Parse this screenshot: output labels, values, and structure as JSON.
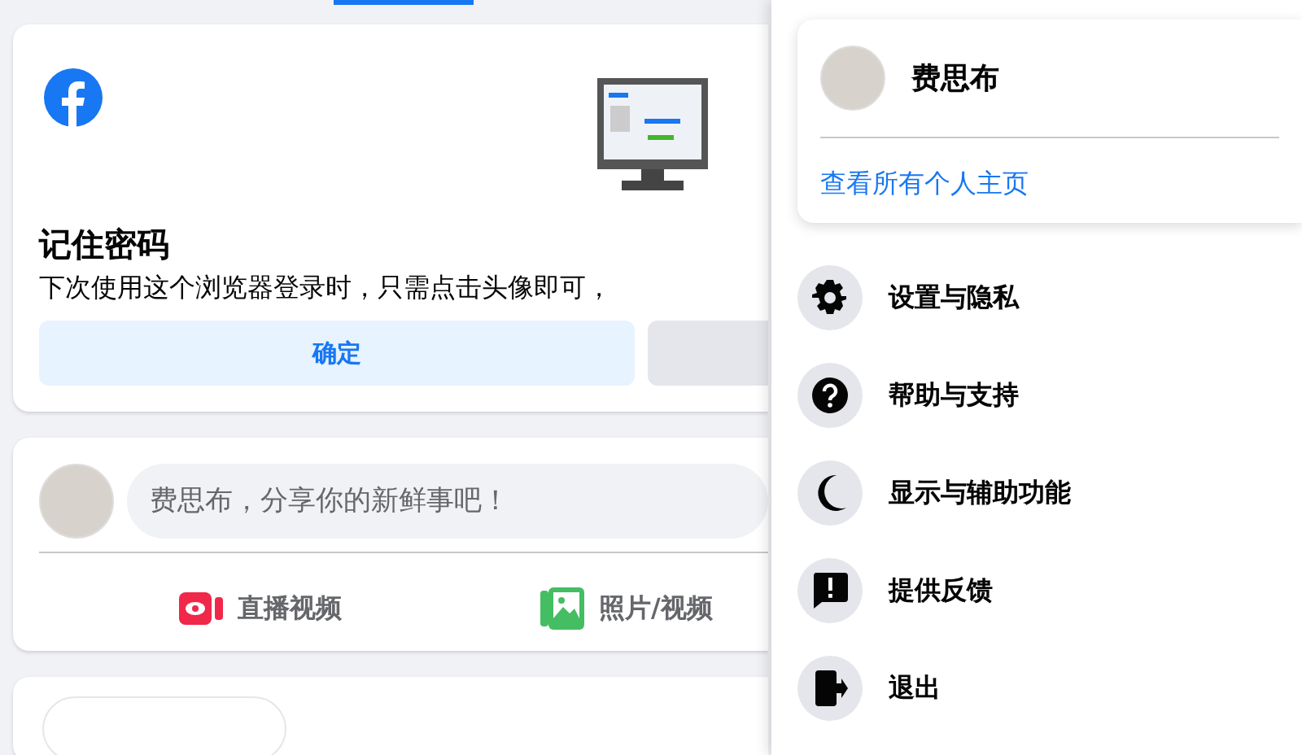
{
  "remember_card": {
    "title": "记住密码",
    "description": "下次使用这个浏览器登录时，只需点击头像即可，",
    "buttons": [
      {
        "label": "确定",
        "kind": "primary"
      },
      {
        "kind": "secondary"
      }
    ]
  },
  "composer": {
    "placeholder": "费思布，分享你的新鲜事吧！",
    "actions": [
      {
        "label": "直播视频",
        "kind": "live"
      },
      {
        "label": "照片/视频",
        "kind": "photo"
      }
    ]
  },
  "account_menu": {
    "profile_name": "费思布",
    "see_all_profiles": "查看所有个人主页",
    "items": [
      {
        "label": "设置与隐私",
        "kind": "settings"
      },
      {
        "label": "帮助与支持",
        "kind": "help"
      },
      {
        "label": "显示与辅助功能",
        "kind": "display"
      },
      {
        "label": "提供反馈",
        "kind": "feedback"
      },
      {
        "label": "退出",
        "kind": "logout"
      }
    ]
  }
}
